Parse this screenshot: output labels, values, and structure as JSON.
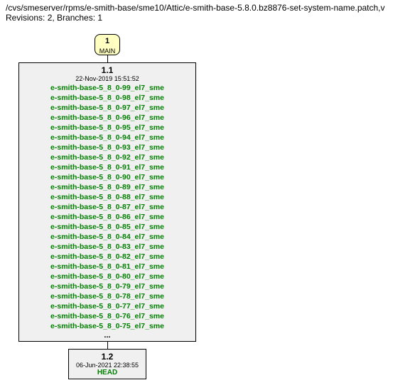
{
  "header": {
    "path": "/cvs/smeserver/rpms/e-smith-base/sme10/Attic/e-smith-base-5.8.0.bz8876-set-system-name.patch,v",
    "revisions_line": "Revisions: 2, Branches: 1"
  },
  "branch_box": {
    "number": "1",
    "label": "MAIN"
  },
  "revision_1_1": {
    "number": "1.1",
    "date": "22-Nov-2019 15:51:52",
    "tags": [
      "e-smith-base-5_8_0-99_el7_sme",
      "e-smith-base-5_8_0-98_el7_sme",
      "e-smith-base-5_8_0-97_el7_sme",
      "e-smith-base-5_8_0-96_el7_sme",
      "e-smith-base-5_8_0-95_el7_sme",
      "e-smith-base-5_8_0-94_el7_sme",
      "e-smith-base-5_8_0-93_el7_sme",
      "e-smith-base-5_8_0-92_el7_sme",
      "e-smith-base-5_8_0-91_el7_sme",
      "e-smith-base-5_8_0-90_el7_sme",
      "e-smith-base-5_8_0-89_el7_sme",
      "e-smith-base-5_8_0-88_el7_sme",
      "e-smith-base-5_8_0-87_el7_sme",
      "e-smith-base-5_8_0-86_el7_sme",
      "e-smith-base-5_8_0-85_el7_sme",
      "e-smith-base-5_8_0-84_el7_sme",
      "e-smith-base-5_8_0-83_el7_sme",
      "e-smith-base-5_8_0-82_el7_sme",
      "e-smith-base-5_8_0-81_el7_sme",
      "e-smith-base-5_8_0-80_el7_sme",
      "e-smith-base-5_8_0-79_el7_sme",
      "e-smith-base-5_8_0-78_el7_sme",
      "e-smith-base-5_8_0-77_el7_sme",
      "e-smith-base-5_8_0-76_el7_sme",
      "e-smith-base-5_8_0-75_el7_sme"
    ],
    "ellipsis": "..."
  },
  "revision_1_2": {
    "number": "1.2",
    "date": "06-Jun-2021 22:38:55",
    "head": "HEAD"
  }
}
